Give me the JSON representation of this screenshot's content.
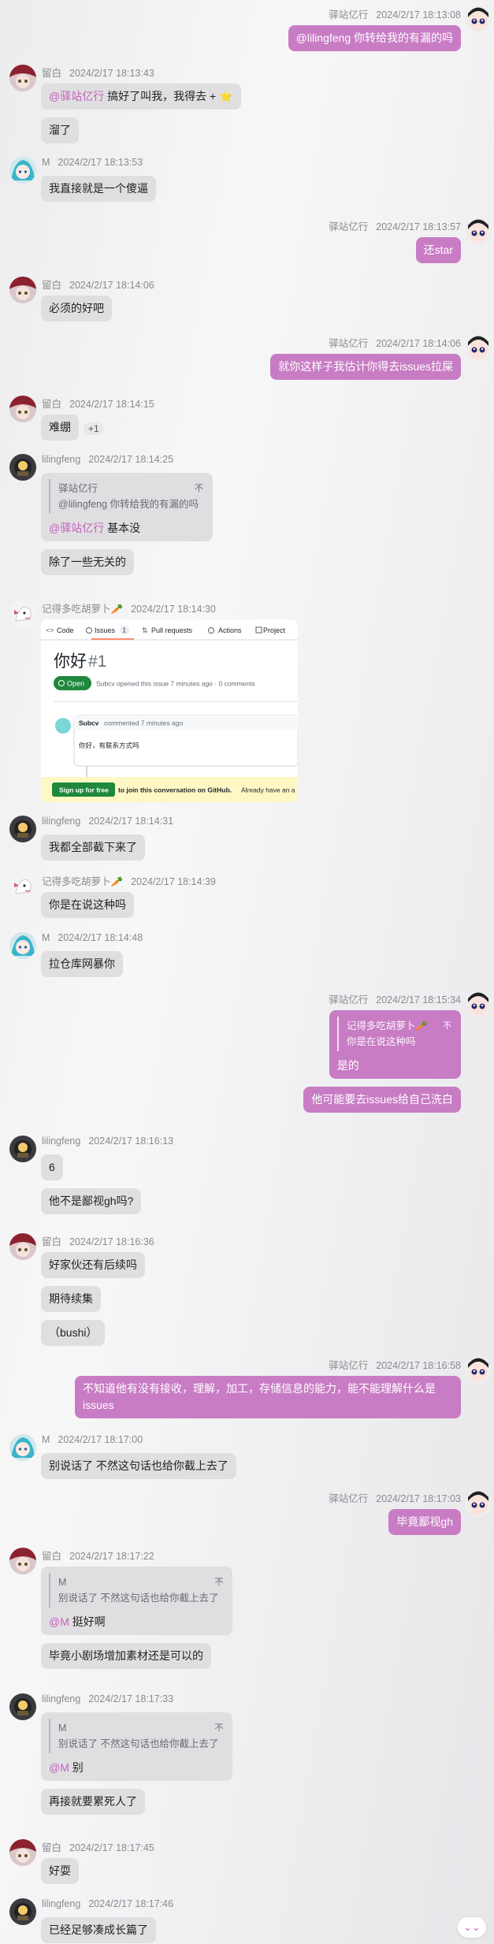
{
  "scroll_button": {
    "icon": "double-chevron-down-icon",
    "glyph": "⌄⌄"
  },
  "colors": {
    "self_bubble": "#c87cc4",
    "other_bubble": "#dfdfe2",
    "mention": "#c364ba",
    "meta": "#8a8a8f"
  },
  "messages": [
    {
      "side": "right",
      "sender": "驿站亿行",
      "time": "2024/2/17 18:13:08",
      "bubbles": [
        {
          "mention": "@lilingfeng",
          "text": " 你转给我的有漏的吗"
        }
      ]
    },
    {
      "side": "left",
      "sender": "留白",
      "time": "2024/2/17 18:13:43",
      "bubbles": [
        {
          "mention": "@驿站亿行",
          "text": " 搞好了叫我，我得去 + ⭐"
        },
        {
          "text": "溜了"
        }
      ]
    },
    {
      "side": "left",
      "sender": "M",
      "time": "2024/2/17 18:13:53",
      "bubbles": [
        {
          "text": "我直接就是一个傻逼"
        }
      ]
    },
    {
      "side": "right",
      "sender": "驿站亿行",
      "time": "2024/2/17 18:13:57",
      "bubbles": [
        {
          "text": "还star"
        }
      ]
    },
    {
      "side": "left",
      "sender": "留白",
      "time": "2024/2/17 18:14:06",
      "bubbles": [
        {
          "text": "必须的好吧"
        }
      ]
    },
    {
      "side": "right",
      "sender": "驿站亿行",
      "time": "2024/2/17 18:14:06",
      "bubbles": [
        {
          "text": "就你这样子我估计你得去issues拉屎"
        }
      ]
    },
    {
      "side": "left",
      "sender": "留白",
      "time": "2024/2/17 18:14:15",
      "bubbles": [
        {
          "text": "难绷"
        }
      ],
      "reaction": "+1"
    },
    {
      "side": "left",
      "sender": "lilingfeng",
      "time": "2024/2/17 18:14:25",
      "bubbles": [
        {
          "quote": {
            "name": "驿站亿行",
            "pin": "不",
            "text": "@lilingfeng 你转给我的有漏的吗"
          },
          "mention": "@驿站亿行",
          "text": " 基本没"
        },
        {
          "text": "除了一些无关的"
        }
      ]
    },
    {
      "side": "left",
      "sender": "记得多吃胡萝卜🥕",
      "time": "2024/2/17 18:14:30",
      "image": {
        "nav": [
          "Code",
          "Issues",
          "1",
          "Pull requests",
          "Actions",
          "Project"
        ],
        "title": "你好",
        "number": "#1",
        "status": "Open",
        "opened": "Subcv opened this issue 7 minutes ago · 0 comments",
        "comment_author": "Subcv",
        "comment_time": "commented 7 minutes ago",
        "comment_body": "你好，有联系方式吗",
        "signup_btn": "Sign up for free",
        "signup_text": "to join this conversation on GitHub.",
        "signup_tail": "Already have an a"
      }
    },
    {
      "side": "left",
      "sender": "lilingfeng",
      "time": "2024/2/17 18:14:31",
      "bubbles": [
        {
          "text": "我都全部截下来了"
        }
      ]
    },
    {
      "side": "left",
      "sender": "记得多吃胡萝卜🥕",
      "time": "2024/2/17 18:14:39",
      "bubbles": [
        {
          "text": "你是在说这种吗"
        }
      ]
    },
    {
      "side": "left",
      "sender": "M",
      "time": "2024/2/17 18:14:48",
      "bubbles": [
        {
          "text": "拉仓库网暴你"
        }
      ]
    },
    {
      "side": "right",
      "sender": "驿站亿行",
      "time": "2024/2/17 18:15:34",
      "bubbles": [
        {
          "quote": {
            "name": "记得多吃胡萝卜🥕",
            "pin": "不",
            "text": "你是在说这种吗"
          },
          "text": "是的"
        },
        {
          "text": "他可能要去issues给自己洗白"
        }
      ]
    },
    {
      "side": "left",
      "sender": "lilingfeng",
      "time": "2024/2/17 18:16:13",
      "bubbles": [
        {
          "text": "6"
        },
        {
          "text": "他不是鄙视gh吗?"
        }
      ]
    },
    {
      "side": "left",
      "sender": "留白",
      "time": "2024/2/17 18:16:36",
      "bubbles": [
        {
          "text": "好家伙还有后续吗"
        },
        {
          "text": "期待续集"
        },
        {
          "text": "（bushi）"
        }
      ]
    },
    {
      "side": "right",
      "sender": "驿站亿行",
      "time": "2024/2/17 18:16:58",
      "bubbles": [
        {
          "text": "不知道他有没有接收，理解，加工，存储信息的能力，能不能理解什么是issues"
        }
      ]
    },
    {
      "side": "left",
      "sender": "M",
      "time": "2024/2/17 18:17:00",
      "bubbles": [
        {
          "text": "别说话了 不然这句话也给你截上去了"
        }
      ]
    },
    {
      "side": "right",
      "sender": "驿站亿行",
      "time": "2024/2/17 18:17:03",
      "bubbles": [
        {
          "text": "毕竟鄙视gh"
        }
      ]
    },
    {
      "side": "left",
      "sender": "留白",
      "time": "2024/2/17 18:17:22",
      "bubbles": [
        {
          "quote": {
            "name": "M",
            "pin": "不",
            "text": "别说话了 不然这句话也给你截上去了"
          },
          "mention": "@M",
          "text": " 挺好啊"
        },
        {
          "text": "毕竟小剧场增加素材还是可以的"
        }
      ]
    },
    {
      "side": "left",
      "sender": "lilingfeng",
      "time": "2024/2/17 18:17:33",
      "bubbles": [
        {
          "quote": {
            "name": "M",
            "pin": "不",
            "text": "别说话了 不然这句话也给你截上去了"
          },
          "mention": "@M",
          "text": " 别"
        },
        {
          "text": "再接就要累死人了"
        }
      ]
    },
    {
      "side": "left",
      "sender": "留白",
      "time": "2024/2/17 18:17:45",
      "bubbles": [
        {
          "text": "好耍"
        }
      ]
    },
    {
      "side": "left",
      "sender": "lilingfeng",
      "time": "2024/2/17 18:17:46",
      "bubbles": [
        {
          "text": "已经足够凑成长篇了"
        }
      ]
    }
  ]
}
